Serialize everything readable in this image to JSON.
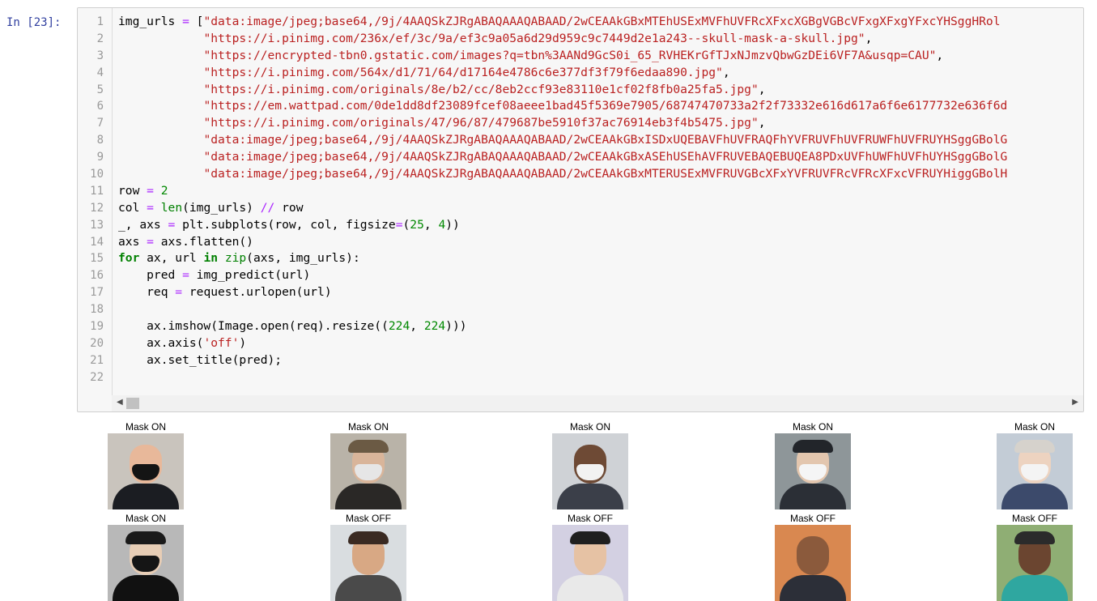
{
  "prompt": "In [23]:",
  "code_lines": [
    [
      [
        "img_urls ",
        ""
      ],
      [
        "=",
        "op"
      ],
      [
        " [",
        ""
      ],
      [
        "\"data:image/jpeg;base64,/9j/4AAQSkZJRgABAQAAAQABAAD/2wCEAAkGBxMTEhUSExMVFhUVFRcXFxcXGBgVGBcVFxgXFxgYFxcYHSggHRol",
        "str"
      ]
    ],
    [
      [
        "            ",
        ""
      ],
      [
        "\"https://i.pinimg.com/236x/ef/3c/9a/ef3c9a05a6d29d959c9c7449d2e1a243--skull-mask-a-skull.jpg\"",
        "str"
      ],
      [
        ",",
        ""
      ]
    ],
    [
      [
        "            ",
        ""
      ],
      [
        "\"https://encrypted-tbn0.gstatic.com/images?q=tbn%3AANd9GcS0i_65_RVHEKrGfTJxNJmzvQbwGzDEi6VF7A&usqp=CAU\"",
        "str"
      ],
      [
        ",",
        ""
      ]
    ],
    [
      [
        "            ",
        ""
      ],
      [
        "\"https://i.pinimg.com/564x/d1/71/64/d17164e4786c6e377df3f79f6edaa890.jpg\"",
        "str"
      ],
      [
        ",",
        ""
      ]
    ],
    [
      [
        "            ",
        ""
      ],
      [
        "\"https://i.pinimg.com/originals/8e/b2/cc/8eb2ccf93e83110e1cf02f8fb0a25fa5.jpg\"",
        "str"
      ],
      [
        ",",
        ""
      ]
    ],
    [
      [
        "            ",
        ""
      ],
      [
        "\"https://em.wattpad.com/0de1dd8df23089fcef08aeee1bad45f5369e7905/68747470733a2f2f73332e616d617a6f6e6177732e636f6d",
        "str"
      ]
    ],
    [
      [
        "            ",
        ""
      ],
      [
        "\"https://i.pinimg.com/originals/47/96/87/479687be5910f37ac76914eb3f4b5475.jpg\"",
        "str"
      ],
      [
        ",",
        ""
      ]
    ],
    [
      [
        "            ",
        ""
      ],
      [
        "\"data:image/jpeg;base64,/9j/4AAQSkZJRgABAQAAAQABAAD/2wCEAAkGBxISDxUQEBAVFhUVFRAQFhYVFRUVFhUVFRUWFhUVFRUYHSggGBolG",
        "str"
      ]
    ],
    [
      [
        "            ",
        ""
      ],
      [
        "\"data:image/jpeg;base64,/9j/4AAQSkZJRgABAQAAAQABAAD/2wCEAAkGBxASEhUSEhAVFRUVEBAQEBUQEA8PDxUVFhUWFhUVFhUYHSggGBolG",
        "str"
      ]
    ],
    [
      [
        "            ",
        ""
      ],
      [
        "\"data:image/jpeg;base64,/9j/4AAQSkZJRgABAQAAAQABAAD/2wCEAAkGBxMTERUSExMVFRUVGBcXFxYVFRUVFRcVFRcXFxcVFRUYHiggGBolH",
        "str"
      ]
    ],
    [
      [
        "row ",
        ""
      ],
      [
        "=",
        "op"
      ],
      [
        " ",
        ""
      ],
      [
        "2",
        "num"
      ]
    ],
    [
      [
        "col ",
        ""
      ],
      [
        "=",
        "op"
      ],
      [
        " ",
        ""
      ],
      [
        "len",
        "bi"
      ],
      [
        "(img_urls) ",
        ""
      ],
      [
        "//",
        "cm"
      ],
      [
        " row",
        ""
      ]
    ],
    [
      [
        "_, axs ",
        ""
      ],
      [
        "=",
        "op"
      ],
      [
        " plt.subplots(row, col, figsize",
        ""
      ],
      [
        "=",
        "op"
      ],
      [
        "(",
        ""
      ],
      [
        "25",
        "num"
      ],
      [
        ", ",
        ""
      ],
      [
        "4",
        "num"
      ],
      [
        "))",
        ""
      ]
    ],
    [
      [
        "axs ",
        ""
      ],
      [
        "=",
        "op"
      ],
      [
        " axs.flatten()",
        ""
      ]
    ],
    [
      [
        "for",
        "kw"
      ],
      [
        " ax, url ",
        ""
      ],
      [
        "in",
        "kw"
      ],
      [
        " ",
        ""
      ],
      [
        "zip",
        "bi"
      ],
      [
        "(axs, img_urls):",
        ""
      ]
    ],
    [
      [
        "    pred ",
        ""
      ],
      [
        "=",
        "op"
      ],
      [
        " img_predict(url)",
        ""
      ]
    ],
    [
      [
        "    req ",
        ""
      ],
      [
        "=",
        "op"
      ],
      [
        " request.urlopen(url)",
        ""
      ]
    ],
    [
      [
        "",
        ""
      ]
    ],
    [
      [
        "    ax.imshow(Image.open(req).resize((",
        ""
      ],
      [
        "224",
        "num"
      ],
      [
        ", ",
        ""
      ],
      [
        "224",
        "num"
      ],
      [
        ")))",
        ""
      ]
    ],
    [
      [
        "    ax.axis(",
        ""
      ],
      [
        "'off'",
        "str"
      ],
      [
        ")",
        ""
      ]
    ],
    [
      [
        "    ax.set_title(pred);",
        ""
      ]
    ],
    [
      [
        "",
        ""
      ]
    ]
  ],
  "line_numbers": [
    "1",
    "2",
    "3",
    "4",
    "5",
    "6",
    "7",
    "8",
    "9",
    "10",
    "11",
    "12",
    "13",
    "14",
    "15",
    "16",
    "17",
    "18",
    "19",
    "20",
    "21",
    "22"
  ],
  "scrollbar": {
    "left_arrow": "◀",
    "right_arrow": "▶"
  },
  "panels": [
    {
      "title": "Mask ON",
      "bg": "#c9c4bd",
      "skin": "#e8b89a",
      "cloth": "#1b1d22",
      "mask": "#141414",
      "hat": ""
    },
    {
      "title": "Mask ON",
      "bg": "#b9b3a8",
      "skin": "#d9b59a",
      "cloth": "#2a2826",
      "mask": "#e6e6e6",
      "hat": "#6b5a44"
    },
    {
      "title": "Mask ON",
      "bg": "#cfd2d6",
      "skin": "#6e4a35",
      "cloth": "#3b3f49",
      "mask": "#f2f2f2",
      "hat": ""
    },
    {
      "title": "Mask ON",
      "bg": "#8e9699",
      "skin": "#e3c6ae",
      "cloth": "#2b2f36",
      "mask": "#f5f5f5",
      "hat": "#22252a"
    },
    {
      "title": "Mask ON",
      "bg": "#c3ccd6",
      "skin": "#edd3c0",
      "cloth": "#3c4a6b",
      "mask": "#f4f4f4",
      "hat": "#d6d2cc"
    },
    {
      "title": "Mask ON",
      "bg": "#b8b8b8",
      "skin": "#e7cdb5",
      "cloth": "#111111",
      "mask": "#151515",
      "hat": "#1a1a1a"
    },
    {
      "title": "Mask OFF",
      "bg": "#d9dde0",
      "skin": "#d8a884",
      "cloth": "#4a4a4a",
      "mask": "",
      "hat": "#3a2a22"
    },
    {
      "title": "Mask OFF",
      "bg": "#d3d0e2",
      "skin": "#e6c2a4",
      "cloth": "#e9e9e9",
      "mask": "",
      "hat": "#1f1f1f"
    },
    {
      "title": "Mask OFF",
      "bg": "#d98850",
      "skin": "#8b5a3c",
      "cloth": "#2c2f38",
      "mask": "",
      "hat": ""
    },
    {
      "title": "Mask OFF",
      "bg": "#8fae74",
      "skin": "#6b4530",
      "cloth": "#2fa7a0",
      "mask": "",
      "hat": "#2b2b2b"
    }
  ]
}
